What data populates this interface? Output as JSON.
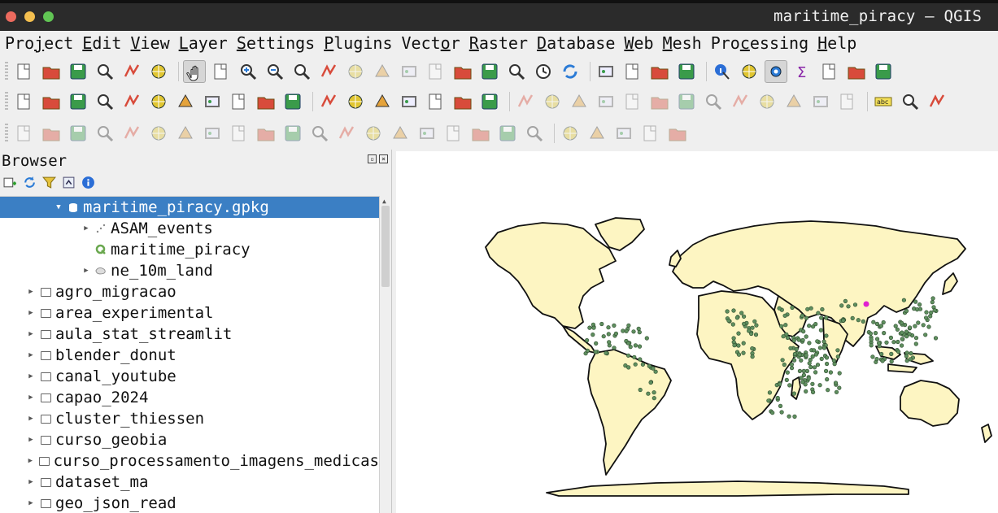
{
  "window": {
    "title": "maritime_piracy — QGIS",
    "traffic_lights": [
      "#ec6a5e",
      "#f4bf4f",
      "#61c554"
    ]
  },
  "menubar": [
    {
      "label": "Project",
      "accel": "j"
    },
    {
      "label": "Edit",
      "accel": "E"
    },
    {
      "label": "View",
      "accel": "V"
    },
    {
      "label": "Layer",
      "accel": "L"
    },
    {
      "label": "Settings",
      "accel": "S"
    },
    {
      "label": "Plugins",
      "accel": "P"
    },
    {
      "label": "Vector",
      "accel": "o"
    },
    {
      "label": "Raster",
      "accel": "R"
    },
    {
      "label": "Database",
      "accel": "D"
    },
    {
      "label": "Web",
      "accel": "W"
    },
    {
      "label": "Mesh",
      "accel": "M"
    },
    {
      "label": "Processing",
      "accel": "c"
    },
    {
      "label": "Help",
      "accel": "H"
    }
  ],
  "toolbar1": [
    "new-project-icon",
    "open-project-icon",
    "save-project-icon",
    "save-as-icon",
    "print-layout-icon",
    "style-manager-icon",
    "|",
    "pan-icon",
    "pan-to-selection-icon",
    "zoom-in-icon",
    "zoom-out-icon",
    "zoom-full-icon",
    "zoom-to-selection-icon",
    "zoom-to-layer-icon",
    "zoom-native-icon",
    "zoom-last-icon",
    "zoom-next-icon",
    "new-bookmark-icon",
    "show-bookmarks-icon",
    "new-map-view-icon",
    "temporal-controller-icon",
    "refresh-icon",
    "|",
    "select-features-icon",
    "select-by-value-icon",
    "deselect-icon",
    "select-location-icon",
    "|",
    "identify-icon",
    "attribute-table-icon",
    "toggle-editing-settings-icon",
    "statistics-icon",
    "attributes-icon",
    "measure-icon",
    "annotation-icon"
  ],
  "toolbar2": [
    "add-vector-layer-icon",
    "add-raster-layer-icon",
    "add-mesh-layer-icon",
    "add-delimited-text-icon",
    "add-gpx-layer-icon",
    "add-spatialite-icon",
    "add-postgis-icon",
    "add-wms-icon",
    "add-wfs-icon",
    "add-wcs-icon",
    "add-virtual-layer-icon",
    "|",
    "new-geopackage-icon",
    "new-temp-layer-icon",
    "new-shapefile-icon",
    "new-spatialite-icon",
    "new-virtual-icon",
    "new-mesh-icon",
    "new-gpx-icon",
    "|",
    "current-edits-icon",
    "toggle-editing-icon",
    "save-edits-icon",
    "add-polygon-icon",
    "vertex-tool-icon",
    "digitize-icon",
    "modify-attributes-icon",
    "delete-selected-icon",
    "cut-features-icon",
    "copy-features-icon",
    "paste-features-icon",
    "undo-icon",
    "redo-icon",
    "|",
    "label-icon",
    "label-pin-icon",
    "label-highlight-icon"
  ],
  "toolbar3": [
    "advanced-digitizing-icon",
    "add-ring-icon",
    "add-part-icon",
    "fill-ring-icon",
    "delete-ring-icon",
    "delete-part-icon",
    "reshape-icon",
    "offset-curve-icon",
    "split-features-icon",
    "split-parts-icon",
    "merge-features-icon",
    "merge-attributes-icon",
    "rotate-point-icon",
    "simplify-icon",
    "reverse-line-icon",
    "trim-extend-icon",
    "rotate-feature-icon",
    "scale-feature-icon",
    "move-feature-icon",
    "copy-move-icon",
    "|",
    "shape-digitize-icon",
    "circle-icon",
    "ellipse-icon",
    "rectangle-icon",
    "polygon-icon"
  ],
  "browser": {
    "title": "Browser",
    "items": [
      {
        "label": "maritime_piracy.gpkg",
        "indent": 1,
        "icon": "geopackage-icon",
        "expanded": true,
        "selected": true
      },
      {
        "label": "ASAM_events",
        "indent": 2,
        "icon": "point-layer-icon",
        "expanded": false
      },
      {
        "label": "maritime_piracy",
        "indent": 2,
        "icon": "qgis-project-icon",
        "leaf": true
      },
      {
        "label": "ne_10m_land",
        "indent": 2,
        "icon": "polygon-layer-icon",
        "expanded": false
      },
      {
        "label": "agro_migracao",
        "indent": 0,
        "icon": "folder-icon"
      },
      {
        "label": "area_experimental",
        "indent": 0,
        "icon": "folder-icon"
      },
      {
        "label": "aula_stat_streamlit",
        "indent": 0,
        "icon": "folder-icon"
      },
      {
        "label": "blender_donut",
        "indent": 0,
        "icon": "folder-icon"
      },
      {
        "label": "canal_youtube",
        "indent": 0,
        "icon": "folder-icon"
      },
      {
        "label": "capao_2024",
        "indent": 0,
        "icon": "folder-icon"
      },
      {
        "label": "cluster_thiessen",
        "indent": 0,
        "icon": "folder-icon"
      },
      {
        "label": "curso_geobia",
        "indent": 0,
        "icon": "folder-icon"
      },
      {
        "label": "curso_processamento_imagens_medicas",
        "indent": 0,
        "icon": "folder-icon"
      },
      {
        "label": "dataset_ma",
        "indent": 0,
        "icon": "folder-icon"
      },
      {
        "label": "geo_json_read",
        "indent": 0,
        "icon": "folder-icon"
      }
    ]
  },
  "map": {
    "land_fill": "#fdf5c2",
    "coast_stroke": "#111111",
    "point_fill": "#5f8f5f",
    "point_stroke": "#2d4a2d",
    "highlight_point": "#e020d0"
  }
}
